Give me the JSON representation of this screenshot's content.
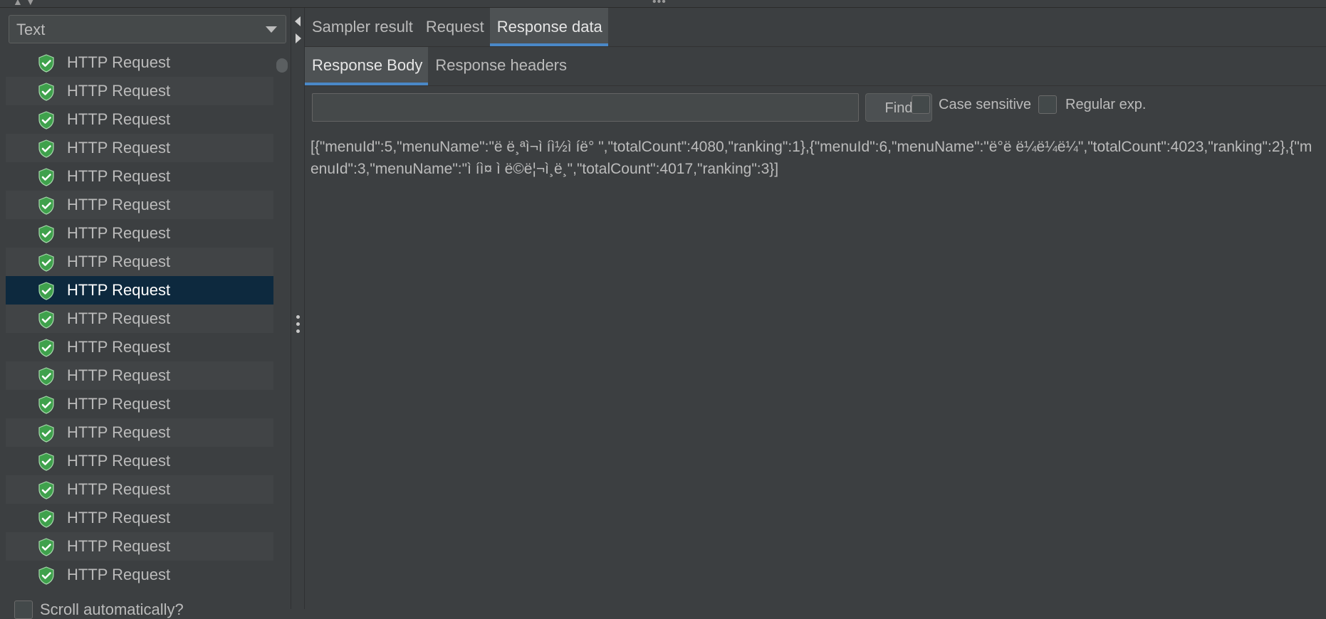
{
  "renderer": {
    "selected": "Text"
  },
  "tree": {
    "item_label": "HTTP Request",
    "items": [
      {
        "label": "HTTP Request",
        "status": "success"
      },
      {
        "label": "HTTP Request",
        "status": "success"
      },
      {
        "label": "HTTP Request",
        "status": "success"
      },
      {
        "label": "HTTP Request",
        "status": "success"
      },
      {
        "label": "HTTP Request",
        "status": "success"
      },
      {
        "label": "HTTP Request",
        "status": "success"
      },
      {
        "label": "HTTP Request",
        "status": "success"
      },
      {
        "label": "HTTP Request",
        "status": "success"
      },
      {
        "label": "HTTP Request",
        "status": "success",
        "selected": true
      },
      {
        "label": "HTTP Request",
        "status": "success"
      },
      {
        "label": "HTTP Request",
        "status": "success"
      },
      {
        "label": "HTTP Request",
        "status": "success"
      },
      {
        "label": "HTTP Request",
        "status": "success"
      },
      {
        "label": "HTTP Request",
        "status": "success"
      },
      {
        "label": "HTTP Request",
        "status": "success"
      },
      {
        "label": "HTTP Request",
        "status": "success"
      },
      {
        "label": "HTTP Request",
        "status": "success"
      },
      {
        "label": "HTTP Request",
        "status": "success"
      },
      {
        "label": "HTTP Request",
        "status": "success"
      }
    ],
    "scroll_auto_label": "Scroll automatically?"
  },
  "tabs": {
    "main": [
      "Sampler result",
      "Request",
      "Response data"
    ],
    "main_active": "Response data",
    "sub": [
      "Response Body",
      "Response headers"
    ],
    "sub_active": "Response Body"
  },
  "search": {
    "value": "",
    "find_label": "Find",
    "case_sensitive_label": "Case sensitive",
    "regex_label": "Regular exp."
  },
  "response_body": "[{\"menuId\":5,\"menuName\":\"ë ë¸ªì¬ì íì½ì íë° \",\"totalCount\":4080,\"ranking\":1},{\"menuId\":6,\"menuName\":\"ë°ë ë¼ë¼ë¼\",\"totalCount\":4023,\"ranking\":2},{\"menuId\":3,\"menuName\":\"ì íì¤ ì ë©ë¦¬ì¸ë¸\",\"totalCount\":4017,\"ranking\":3}]",
  "colors": {
    "background": "#3c3f41",
    "selected_row": "#0d293e",
    "tab_accent": "#4a88c7",
    "success_icon": "#3fa14c"
  }
}
